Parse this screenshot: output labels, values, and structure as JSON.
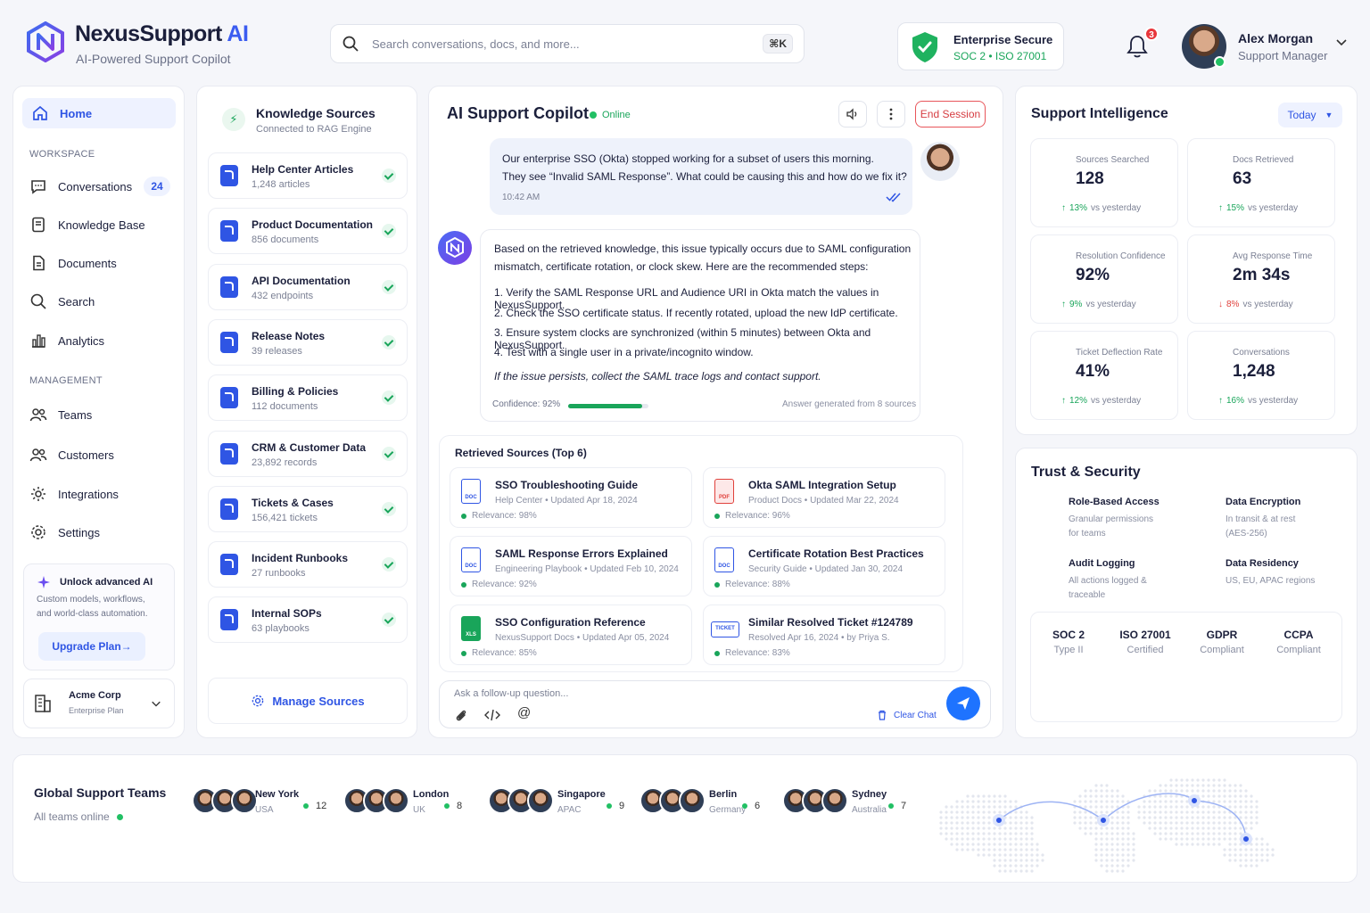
{
  "brand": {
    "name": "NexusSupport",
    "ai": "AI",
    "tagline": "AI-Powered Support Copilot"
  },
  "search": {
    "placeholder": "Search conversations, docs, and more...",
    "shortcut": "⌘K"
  },
  "security_badge": {
    "title": "Enterprise Secure",
    "certs": "SOC 2  •  ISO 27001"
  },
  "notifications": {
    "count": "3"
  },
  "user": {
    "name": "Alex Morgan",
    "role": "Support Manager"
  },
  "sidebar": {
    "home": "Home",
    "workspace_label": "WORKSPACE",
    "management_label": "MANAGEMENT",
    "items": [
      "Conversations",
      "Knowledge Base",
      "Documents",
      "Search",
      "Analytics"
    ],
    "conversations_count": "24",
    "mgmt_items": [
      "Teams",
      "Customers",
      "Integrations",
      "Settings"
    ],
    "unlock_title": "Unlock advanced AI",
    "unlock_desc1": "Custom models, workflows,",
    "unlock_desc2": "and world-class automation.",
    "upgrade": "Upgrade Plan",
    "org_name": "Acme Corp",
    "org_plan": "Enterprise Plan"
  },
  "knowledge": {
    "title": "Knowledge Sources",
    "subtitle": "Connected to RAG Engine",
    "items": [
      {
        "name": "Help Center Articles",
        "meta": "1,248 articles"
      },
      {
        "name": "Product Documentation",
        "meta": "856 documents"
      },
      {
        "name": "API Documentation",
        "meta": "432 endpoints"
      },
      {
        "name": "Release Notes",
        "meta": "39 releases"
      },
      {
        "name": "Billing & Policies",
        "meta": "112 documents"
      },
      {
        "name": "CRM & Customer Data",
        "meta": "23,892 records"
      },
      {
        "name": "Tickets & Cases",
        "meta": "156,421 tickets"
      },
      {
        "name": "Incident Runbooks",
        "meta": "27 runbooks"
      },
      {
        "name": "Internal SOPs",
        "meta": "63 playbooks"
      }
    ],
    "manage": "Manage Sources"
  },
  "chat": {
    "title": "AI Support Copilot",
    "status": "Online",
    "end_session": "End Session",
    "user_msg_1": "Our enterprise SSO (Okta) stopped working for a subset of users this morning.",
    "user_msg_2": "They see “Invalid SAML Response”. What could be causing this and how do we fix it?",
    "user_time": "10:42 AM",
    "bot_intro_1": "Based on the retrieved knowledge, this issue typically occurs due to SAML configuration",
    "bot_intro_2": "mismatch, certificate rotation, or clock skew. Here are the recommended steps:",
    "steps": [
      "1.   Verify the SAML Response URL and Audience URI in Okta match the values in NexusSupport.",
      "2.   Check the SSO certificate status. If recently rotated, upload the new IdP certificate.",
      "3.   Ensure system clocks are synchronized (within 5 minutes) between Okta and NexusSupport.",
      "4.   Test with a single user in a private/incognito window."
    ],
    "bot_note": "If the issue persists, collect the SAML trace logs and contact support.",
    "confidence_label": "Confidence: 92%",
    "confidence": 0.92,
    "sources_note": "Answer generated from 8 sources",
    "retrieved_title": "Retrieved Sources (Top 6)",
    "sources": [
      {
        "name": "SSO Troubleshooting Guide",
        "meta": "Help Center   •   Updated Apr 18, 2024",
        "rel": "Relevance: 98%",
        "type": "DOC"
      },
      {
        "name": "Okta SAML Integration Setup",
        "meta": "Product Docs   •   Updated Mar 22, 2024",
        "rel": "Relevance: 96%",
        "type": "PDF"
      },
      {
        "name": "SAML Response Errors Explained",
        "meta": "Engineering Playbook   •   Updated Feb 10, 2024",
        "rel": "Relevance: 92%",
        "type": "DOC"
      },
      {
        "name": "Certificate Rotation Best Practices",
        "meta": "Security Guide   •   Updated Jan 30, 2024",
        "rel": "Relevance: 88%",
        "type": "DOC"
      },
      {
        "name": "SSO Configuration Reference",
        "meta": "NexusSupport Docs   •   Updated Apr 05, 2024",
        "rel": "Relevance: 85%",
        "type": "XLS"
      },
      {
        "name": "Similar Resolved Ticket #124789",
        "meta": "Resolved Apr 16, 2024   •   by Priya S.",
        "rel": "Relevance: 83%",
        "type": "TICKET"
      }
    ],
    "composer_placeholder": "Ask a follow-up question...",
    "clear_chat": "Clear Chat"
  },
  "intel": {
    "title": "Support Intelligence",
    "range": "Today",
    "stats": [
      {
        "label": "Sources Searched",
        "value": "128",
        "delta": "13%",
        "dir": "up",
        "cmp": "vs yesterday"
      },
      {
        "label": "Docs Retrieved",
        "value": "63",
        "delta": "15%",
        "dir": "up",
        "cmp": "vs yesterday"
      },
      {
        "label": "Resolution Confidence",
        "value": "92%",
        "delta": "9%",
        "dir": "up",
        "cmp": "vs yesterday"
      },
      {
        "label": "Avg Response Time",
        "value": "2m 34s",
        "delta": "8%",
        "dir": "down",
        "cmp": "vs yesterday"
      },
      {
        "label": "Ticket Deflection Rate",
        "value": "41%",
        "delta": "12%",
        "dir": "up",
        "cmp": "vs yesterday"
      },
      {
        "label": "Conversations",
        "value": "1,248",
        "delta": "16%",
        "dir": "up",
        "cmp": "vs yesterday"
      }
    ]
  },
  "trust": {
    "title": "Trust & Security",
    "items": [
      {
        "h": "Role-Based Access",
        "s": "Granular permissions for teams"
      },
      {
        "h": "Data Encryption",
        "s": "In transit & at rest (AES-256)"
      },
      {
        "h": "Audit Logging",
        "s": "All actions logged & traceable"
      },
      {
        "h": "Data Residency",
        "s": "US, EU, APAC regions"
      }
    ],
    "certs": [
      {
        "n": "SOC 2",
        "s": "Type II"
      },
      {
        "n": "ISO 27001",
        "s": "Certified"
      },
      {
        "n": "GDPR",
        "s": "Compliant"
      },
      {
        "n": "CCPA",
        "s": "Compliant"
      }
    ]
  },
  "teams": {
    "title": "Global Support Teams",
    "subtitle": "All teams online",
    "list": [
      {
        "city": "New York",
        "region": "USA",
        "count": "12"
      },
      {
        "city": "London",
        "region": "UK",
        "count": "8"
      },
      {
        "city": "Singapore",
        "region": "APAC",
        "count": "9"
      },
      {
        "city": "Berlin",
        "region": "Germany",
        "count": "6"
      },
      {
        "city": "Sydney",
        "region": "Australia",
        "count": "7"
      }
    ]
  }
}
